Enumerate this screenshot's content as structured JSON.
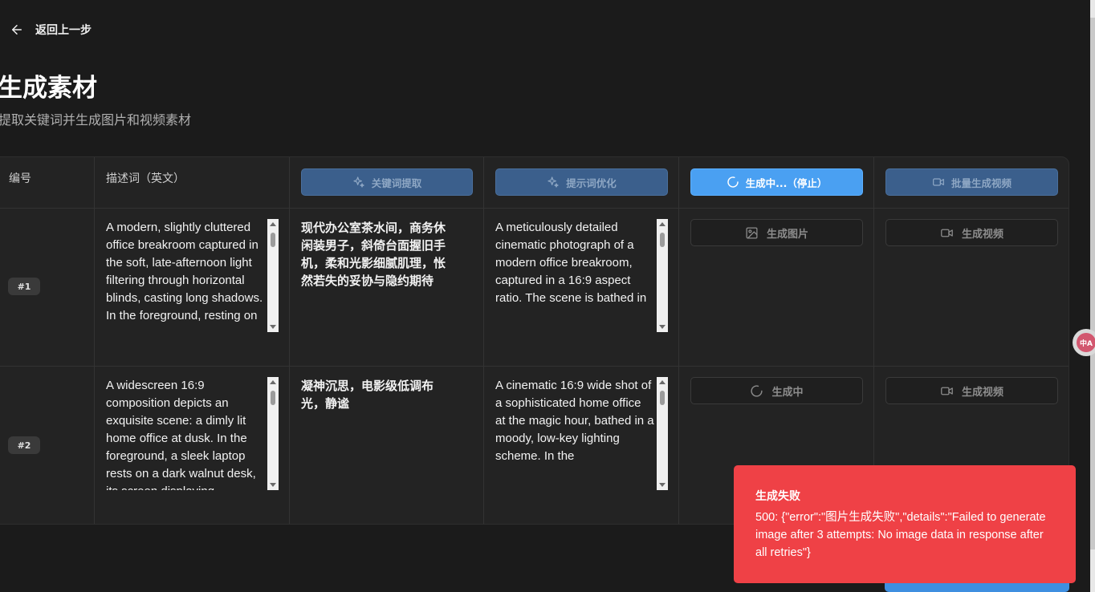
{
  "nav": {
    "back_label": "返回上一步"
  },
  "page": {
    "title": "生成素材",
    "subtitle": "提取关键词并生成图片和视频素材"
  },
  "table": {
    "headers": {
      "number": "编号",
      "description": "描述词（英文）",
      "extract_button": "关键词提取",
      "optimize_button": "提示词优化",
      "generate_button": "生成中...（停止）",
      "batch_video_button": "批量生成视频"
    },
    "rows": [
      {
        "badge": "#1",
        "description": "A modern, slightly cluttered office breakroom captured in the soft, late-afternoon light filtering through horizontal blinds, casting long shadows. In the foreground, resting on",
        "keywords": "现代办公室茶水间，商务休闲装男子，斜倚台面握旧手机，柔和光影细腻肌理，怅然若失的妥协与隐约期待",
        "optimized": "A meticulously detailed cinematic photograph of a modern office breakroom, captured in a 16:9 aspect ratio. The scene is bathed in",
        "image_button": "生成图片",
        "video_button": "生成视频"
      },
      {
        "badge": "#2",
        "description": "A widescreen 16:9 composition depicts an exquisite scene: a dimly lit home office at dusk. In the foreground, a sleek laptop rests on a dark walnut desk, its screen displaying",
        "keywords": "凝神沉思，电影级低调布光，静谧",
        "optimized": "A cinematic 16:9 wide shot of a sophisticated home office at the magic hour, bathed in a moody, low-key lighting scheme. In the",
        "image_button": "生成中",
        "video_button": "生成视频"
      }
    ]
  },
  "toast": {
    "title": "生成失败",
    "message": "500: {\"error\":\"图片生成失败\",\"details\":\"Failed to generate image after 3 attempts: No image data in response after all retries\"}"
  },
  "colors": {
    "background": "#1b1b1b",
    "table_bg": "#232323",
    "accent_blue": "#4aa0f2",
    "muted_blue": "#3b5f8c",
    "error_red": "#ef4146"
  },
  "float_badge": {
    "icon": "translate-icon"
  }
}
